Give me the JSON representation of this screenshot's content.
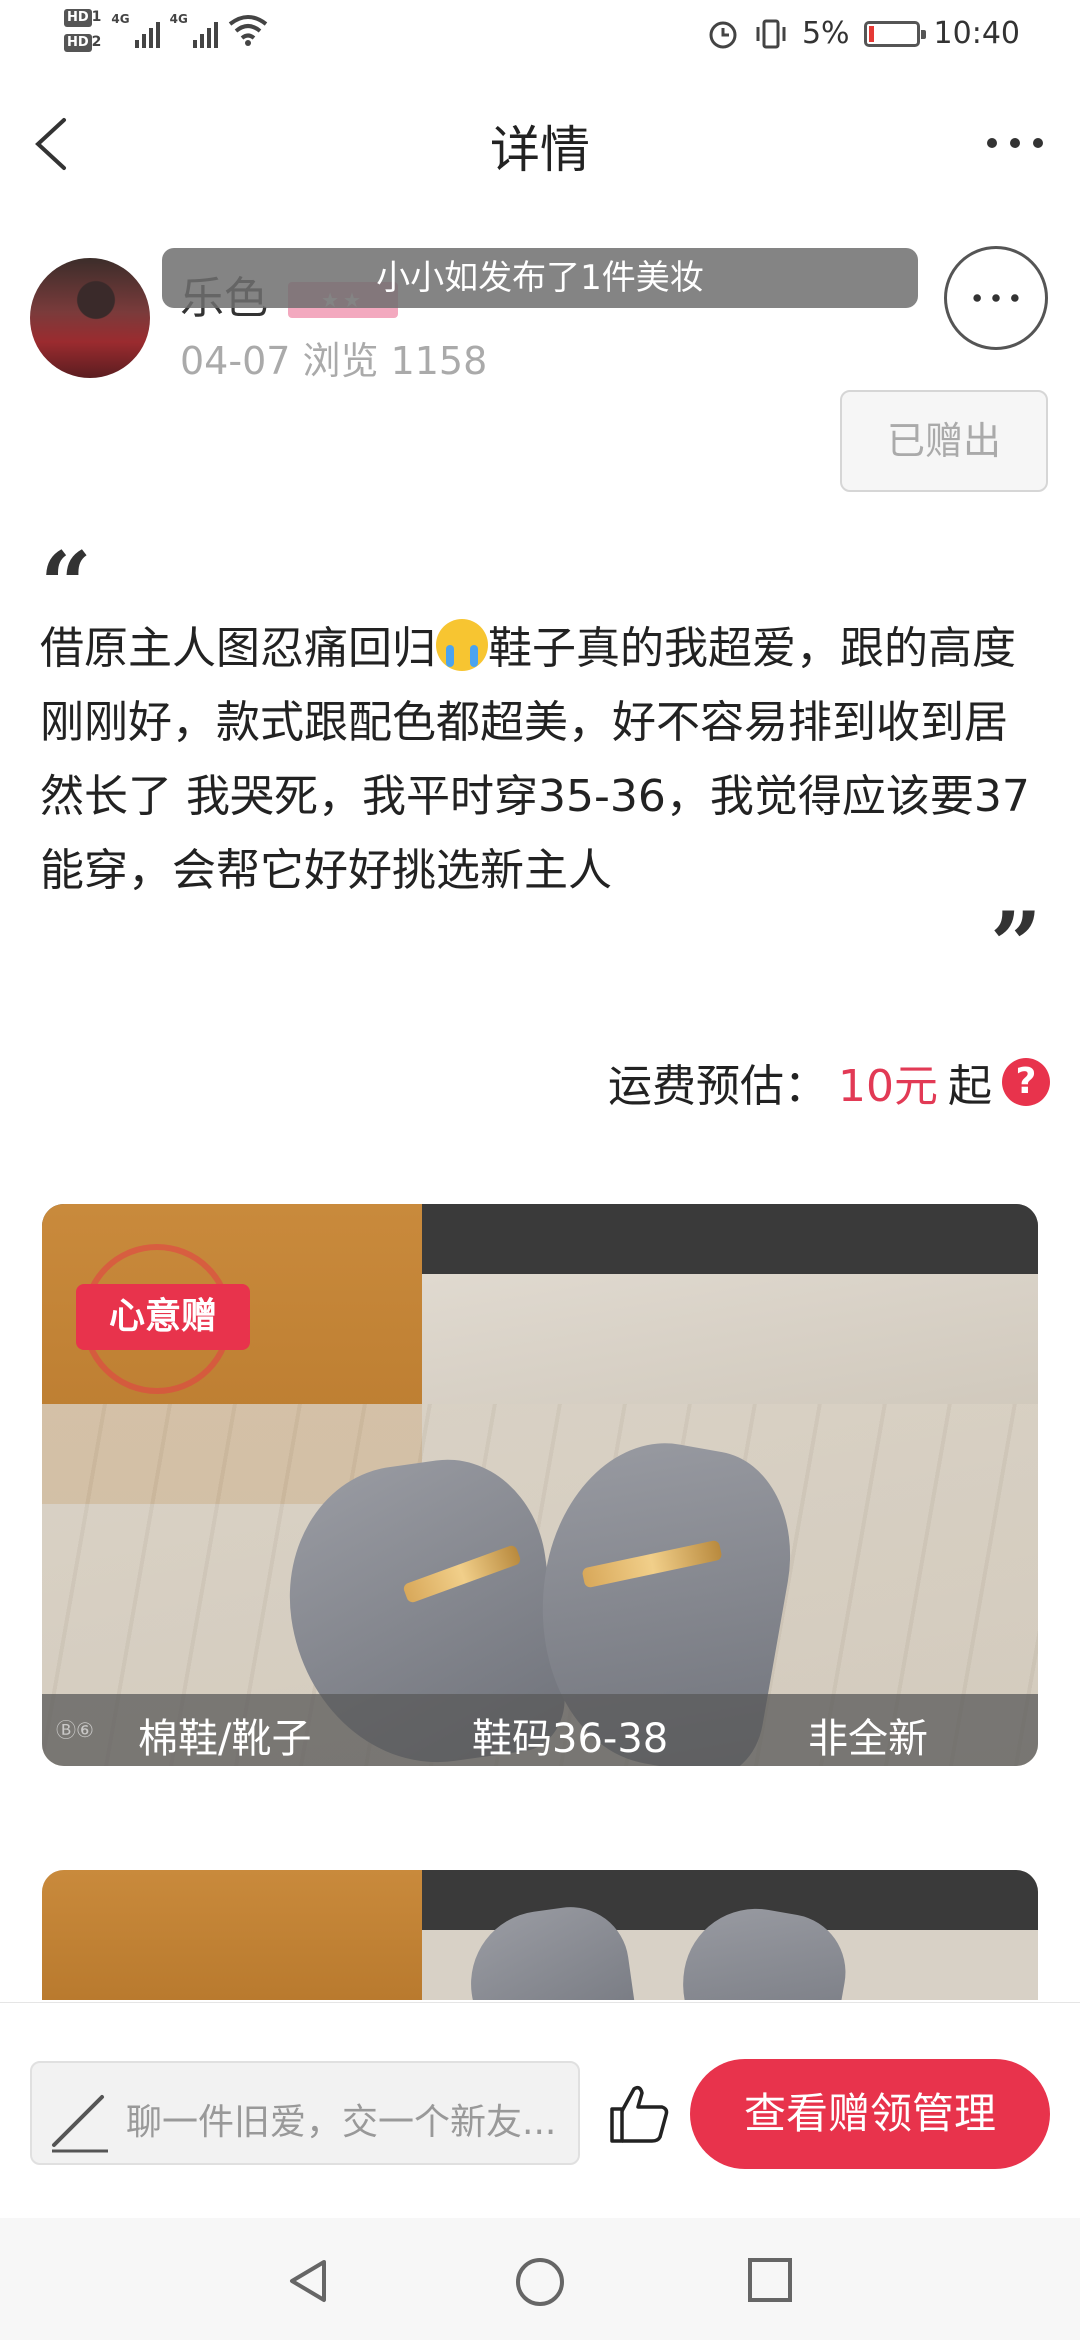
{
  "status_bar": {
    "hd1": "HD",
    "hd1_sub": "1",
    "hd2": "HD",
    "hd2_sub": "2",
    "net1": "4G",
    "net2": "4G",
    "battery_percent": "5%",
    "time": "10:40"
  },
  "nav": {
    "title": "详情"
  },
  "post": {
    "user_name": "乐色",
    "level_stars": "★★",
    "meta": "04-07 浏览 1158",
    "toast": "小小如发布了1件美妆",
    "gifted_label": "已赠出",
    "quote_open": "“",
    "description_part1": "借原主人图忍痛回归",
    "description_part2": "鞋子真的我超爱，跟的高度刚刚好，款式跟配色都超美，好不容易排到收到居然长了 我哭死，我平时穿35-36，我觉得应该要37能穿，会帮它好好挑选新主人",
    "quote_close": "”"
  },
  "shipping": {
    "label": "运费预估：",
    "price": "10元",
    "suffix": "起",
    "help_symbol": "?"
  },
  "photo": {
    "stamp_label": "心意赠",
    "badge_icons": "Ⓑ⑥",
    "category": "棉鞋/靴子",
    "size": "鞋码36-38",
    "condition": "非全新"
  },
  "bottom_bar": {
    "comment_placeholder": "聊一件旧爱，交一个新友...",
    "manage_button": "查看赠领管理"
  },
  "colors": {
    "accent": "#e8334c",
    "price": "#e23a55"
  }
}
